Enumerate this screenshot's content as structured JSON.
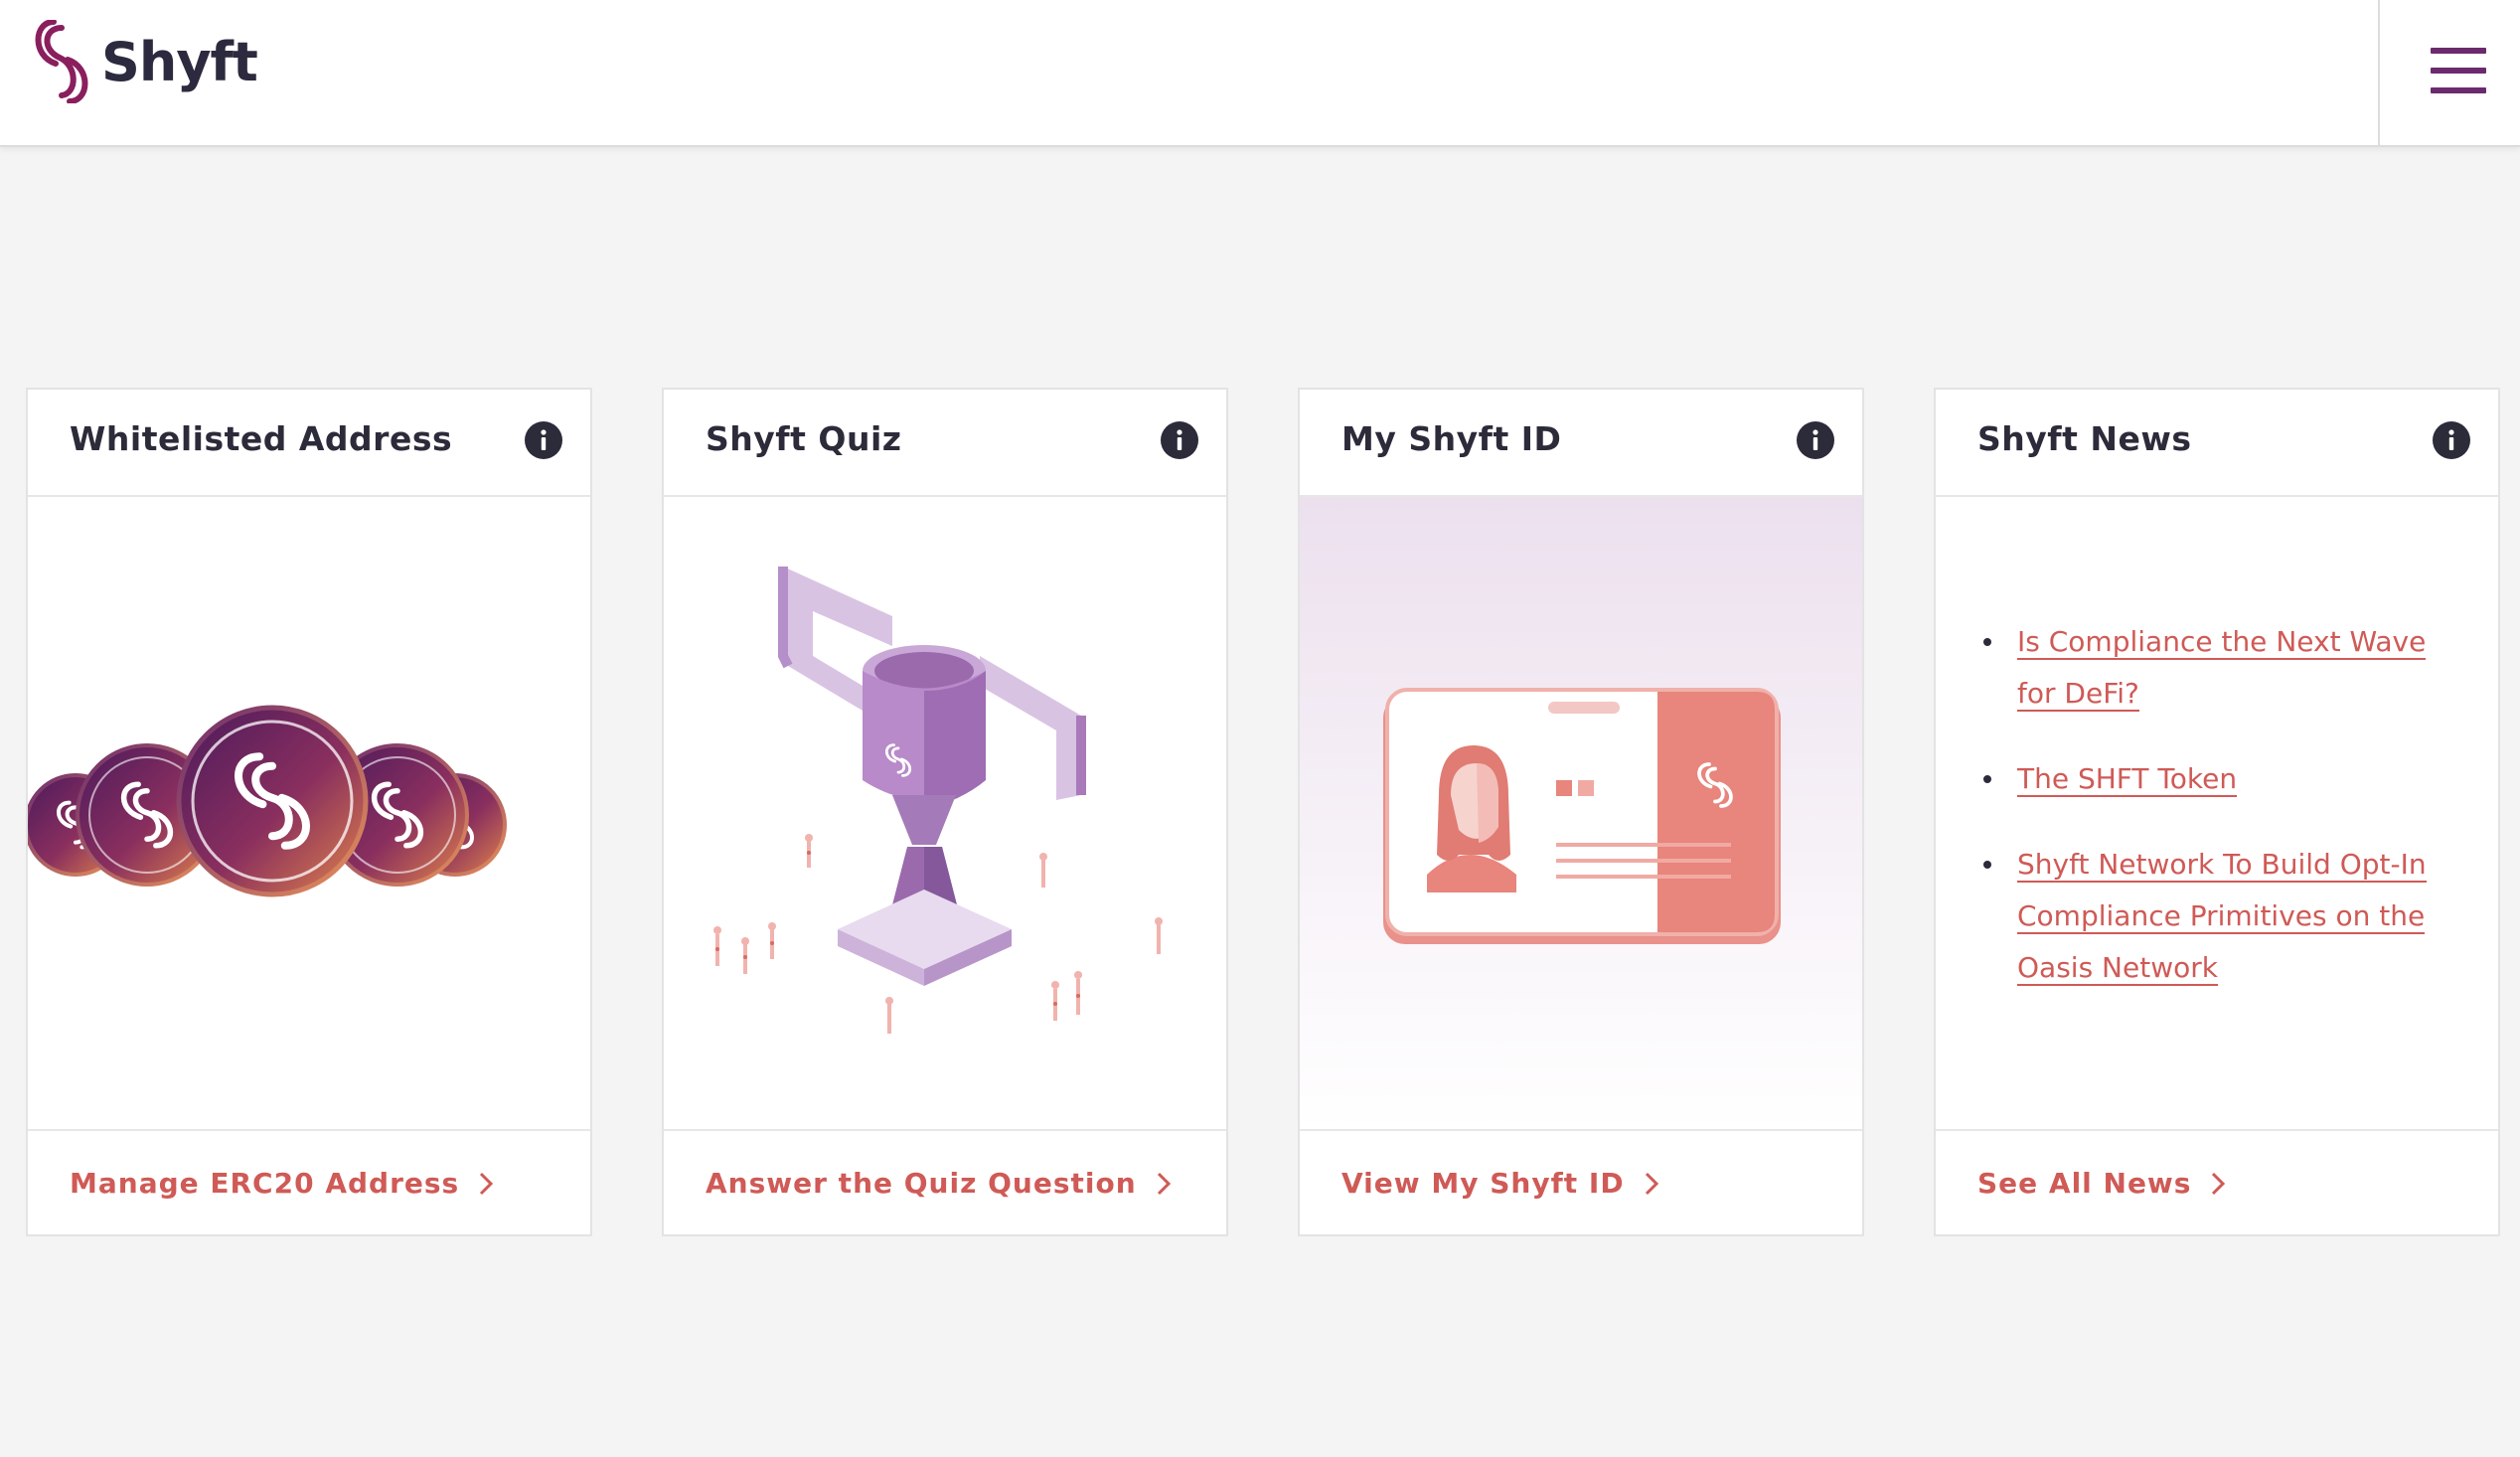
{
  "brand": {
    "name": "Shyft",
    "color": "#6b2a6e",
    "accent": "#cf5a56"
  },
  "header": {
    "menu_icon": "hamburger-menu-icon"
  },
  "cards": [
    {
      "title": "Whitelisted Address",
      "info_icon": "info-icon",
      "illustration": "shyft-coins-illustration",
      "link_label": "Manage ERC20 Address"
    },
    {
      "title": "Shyft Quiz",
      "info_icon": "info-icon",
      "illustration": "trophy-illustration",
      "link_label": "Answer the Quiz Question"
    },
    {
      "title": "My Shyft ID",
      "info_icon": "info-icon",
      "illustration": "id-card-illustration",
      "link_label": "View My Shyft ID"
    },
    {
      "title": "Shyft News",
      "info_icon": "info-icon",
      "news": [
        "Is Compliance the Next Wave for DeFi?",
        "The SHFT Token",
        "Shyft Network To Build Opt-In Compliance Primitives on the Oasis Network"
      ],
      "link_label": "See All News"
    }
  ]
}
